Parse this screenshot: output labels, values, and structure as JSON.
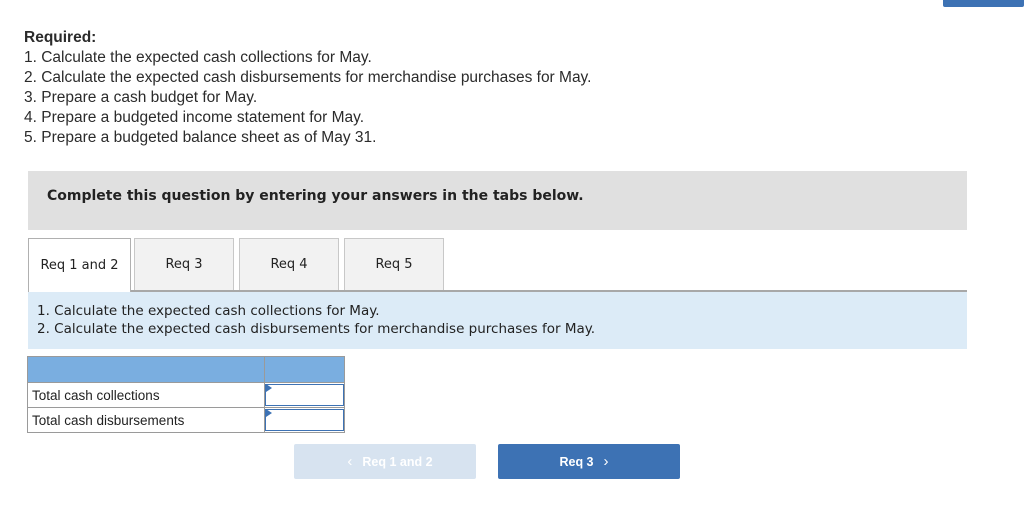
{
  "required": {
    "title": "Required:",
    "items": [
      "1. Calculate the expected cash collections for May.",
      "2. Calculate the expected cash disbursements for merchandise purchases for May.",
      "3. Prepare a cash budget for May.",
      "4. Prepare a budgeted income statement for May.",
      "5. Prepare a budgeted balance sheet as of May 31."
    ]
  },
  "instruction": "Complete this question by entering your answers in the tabs below.",
  "tabs": [
    {
      "label": "Req 1 and 2",
      "active": true
    },
    {
      "label": "Req 3",
      "active": false
    },
    {
      "label": "Req 4",
      "active": false
    },
    {
      "label": "Req 5",
      "active": false
    }
  ],
  "description": [
    "1. Calculate the expected cash collections for May.",
    "2. Calculate the expected cash disbursements for merchandise purchases for May."
  ],
  "table": {
    "rows": [
      {
        "label": "Total cash collections",
        "value": ""
      },
      {
        "label": "Total cash disbursements",
        "value": ""
      }
    ]
  },
  "nav": {
    "prev_label": "Req 1 and 2",
    "next_label": "Req 3",
    "prev_icon": "chevron-left",
    "next_icon": "chevron-right"
  },
  "colors": {
    "accent": "#3d72b4",
    "table_header": "#7aaee0",
    "description_bg": "#dcebf7",
    "instruction_bg": "#e0e0e0"
  }
}
